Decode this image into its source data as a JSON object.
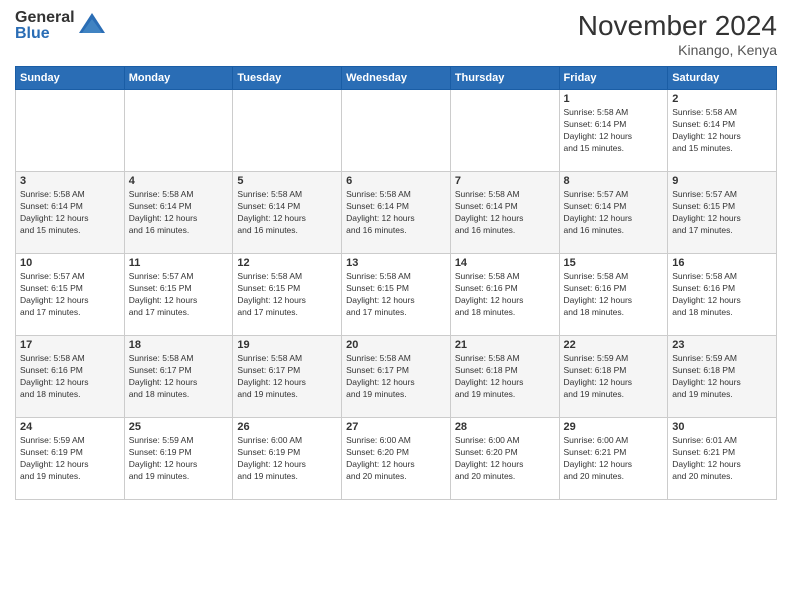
{
  "logo": {
    "general": "General",
    "blue": "Blue"
  },
  "title": "November 2024",
  "location": "Kinango, Kenya",
  "days_of_week": [
    "Sunday",
    "Monday",
    "Tuesday",
    "Wednesday",
    "Thursday",
    "Friday",
    "Saturday"
  ],
  "weeks": [
    [
      {
        "day": "",
        "info": ""
      },
      {
        "day": "",
        "info": ""
      },
      {
        "day": "",
        "info": ""
      },
      {
        "day": "",
        "info": ""
      },
      {
        "day": "",
        "info": ""
      },
      {
        "day": "1",
        "info": "Sunrise: 5:58 AM\nSunset: 6:14 PM\nDaylight: 12 hours\nand 15 minutes."
      },
      {
        "day": "2",
        "info": "Sunrise: 5:58 AM\nSunset: 6:14 PM\nDaylight: 12 hours\nand 15 minutes."
      }
    ],
    [
      {
        "day": "3",
        "info": "Sunrise: 5:58 AM\nSunset: 6:14 PM\nDaylight: 12 hours\nand 15 minutes."
      },
      {
        "day": "4",
        "info": "Sunrise: 5:58 AM\nSunset: 6:14 PM\nDaylight: 12 hours\nand 16 minutes."
      },
      {
        "day": "5",
        "info": "Sunrise: 5:58 AM\nSunset: 6:14 PM\nDaylight: 12 hours\nand 16 minutes."
      },
      {
        "day": "6",
        "info": "Sunrise: 5:58 AM\nSunset: 6:14 PM\nDaylight: 12 hours\nand 16 minutes."
      },
      {
        "day": "7",
        "info": "Sunrise: 5:58 AM\nSunset: 6:14 PM\nDaylight: 12 hours\nand 16 minutes."
      },
      {
        "day": "8",
        "info": "Sunrise: 5:57 AM\nSunset: 6:14 PM\nDaylight: 12 hours\nand 16 minutes."
      },
      {
        "day": "9",
        "info": "Sunrise: 5:57 AM\nSunset: 6:15 PM\nDaylight: 12 hours\nand 17 minutes."
      }
    ],
    [
      {
        "day": "10",
        "info": "Sunrise: 5:57 AM\nSunset: 6:15 PM\nDaylight: 12 hours\nand 17 minutes."
      },
      {
        "day": "11",
        "info": "Sunrise: 5:57 AM\nSunset: 6:15 PM\nDaylight: 12 hours\nand 17 minutes."
      },
      {
        "day": "12",
        "info": "Sunrise: 5:58 AM\nSunset: 6:15 PM\nDaylight: 12 hours\nand 17 minutes."
      },
      {
        "day": "13",
        "info": "Sunrise: 5:58 AM\nSunset: 6:15 PM\nDaylight: 12 hours\nand 17 minutes."
      },
      {
        "day": "14",
        "info": "Sunrise: 5:58 AM\nSunset: 6:16 PM\nDaylight: 12 hours\nand 18 minutes."
      },
      {
        "day": "15",
        "info": "Sunrise: 5:58 AM\nSunset: 6:16 PM\nDaylight: 12 hours\nand 18 minutes."
      },
      {
        "day": "16",
        "info": "Sunrise: 5:58 AM\nSunset: 6:16 PM\nDaylight: 12 hours\nand 18 minutes."
      }
    ],
    [
      {
        "day": "17",
        "info": "Sunrise: 5:58 AM\nSunset: 6:16 PM\nDaylight: 12 hours\nand 18 minutes."
      },
      {
        "day": "18",
        "info": "Sunrise: 5:58 AM\nSunset: 6:17 PM\nDaylight: 12 hours\nand 18 minutes."
      },
      {
        "day": "19",
        "info": "Sunrise: 5:58 AM\nSunset: 6:17 PM\nDaylight: 12 hours\nand 19 minutes."
      },
      {
        "day": "20",
        "info": "Sunrise: 5:58 AM\nSunset: 6:17 PM\nDaylight: 12 hours\nand 19 minutes."
      },
      {
        "day": "21",
        "info": "Sunrise: 5:58 AM\nSunset: 6:18 PM\nDaylight: 12 hours\nand 19 minutes."
      },
      {
        "day": "22",
        "info": "Sunrise: 5:59 AM\nSunset: 6:18 PM\nDaylight: 12 hours\nand 19 minutes."
      },
      {
        "day": "23",
        "info": "Sunrise: 5:59 AM\nSunset: 6:18 PM\nDaylight: 12 hours\nand 19 minutes."
      }
    ],
    [
      {
        "day": "24",
        "info": "Sunrise: 5:59 AM\nSunset: 6:19 PM\nDaylight: 12 hours\nand 19 minutes."
      },
      {
        "day": "25",
        "info": "Sunrise: 5:59 AM\nSunset: 6:19 PM\nDaylight: 12 hours\nand 19 minutes."
      },
      {
        "day": "26",
        "info": "Sunrise: 6:00 AM\nSunset: 6:19 PM\nDaylight: 12 hours\nand 19 minutes."
      },
      {
        "day": "27",
        "info": "Sunrise: 6:00 AM\nSunset: 6:20 PM\nDaylight: 12 hours\nand 20 minutes."
      },
      {
        "day": "28",
        "info": "Sunrise: 6:00 AM\nSunset: 6:20 PM\nDaylight: 12 hours\nand 20 minutes."
      },
      {
        "day": "29",
        "info": "Sunrise: 6:00 AM\nSunset: 6:21 PM\nDaylight: 12 hours\nand 20 minutes."
      },
      {
        "day": "30",
        "info": "Sunrise: 6:01 AM\nSunset: 6:21 PM\nDaylight: 12 hours\nand 20 minutes."
      }
    ]
  ]
}
